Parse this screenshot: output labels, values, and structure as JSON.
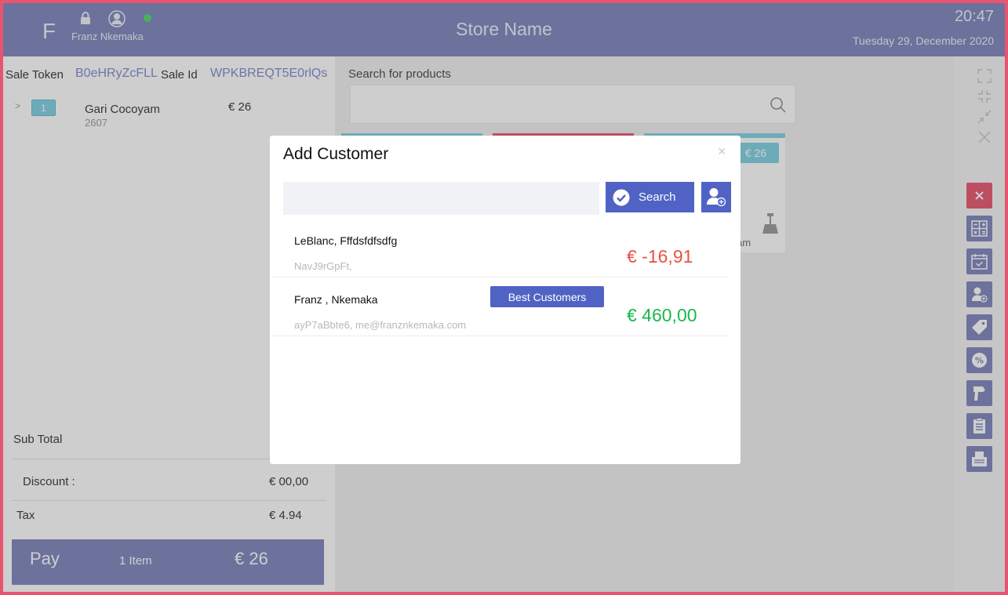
{
  "header": {
    "initial": "F",
    "user_name": "Franz Nkemaka",
    "store_name": "Store Name",
    "time": "20:47",
    "date": "Tuesday 29, December  2020",
    "status_color": "#4cd964"
  },
  "sale": {
    "token_label": "Sale Token",
    "token_value": "B0eHRyZcFLL",
    "id_label": "Sale  Id",
    "id_value": "WPKBREQT5E0rlQs"
  },
  "cart": {
    "items": [
      {
        "qty": "1",
        "name": "Gari Cocoyam",
        "code": "2607",
        "price": "€ 26"
      }
    ]
  },
  "totals": {
    "subtotal_label": "Sub Total",
    "discount_label": "Discount :",
    "discount_value": "€ 00,00",
    "tax_label": "Tax",
    "tax_value": "€ 4.94"
  },
  "pay": {
    "label": "Pay",
    "items": "1 Item",
    "total": "€ 26"
  },
  "products": {
    "search_label": "Search for products",
    "card_price": "€ 26",
    "card_partial_text": "am"
  },
  "modal": {
    "title": "Add Customer",
    "close": "×",
    "search_placeholder": "",
    "search_button": "Search",
    "customers": [
      {
        "name": "LeBlanc, Fffdsfdfsdfg",
        "meta": "NavJ9rGpFt,",
        "balance": "€ -16,91",
        "balance_color": "#e8533f",
        "badge": ""
      },
      {
        "name": "Franz , Nkemaka",
        "meta": "ayP7aBbte6, me@franznkemaka.com",
        "balance": "€ 460,00",
        "balance_color": "#19b94a",
        "badge": "Best Customers"
      }
    ]
  },
  "colors": {
    "accent": "#7c85bd",
    "button_blue": "#5063c4",
    "danger": "#e8546f",
    "cyan": "#7fd0e3"
  },
  "icons": {
    "rail": [
      "calculator-icon",
      "calendar-check-icon",
      "add-user-icon",
      "tag-icon",
      "percent-badge-icon",
      "barcode-scanner-icon",
      "clipboard-icon",
      "printer-icon"
    ]
  }
}
